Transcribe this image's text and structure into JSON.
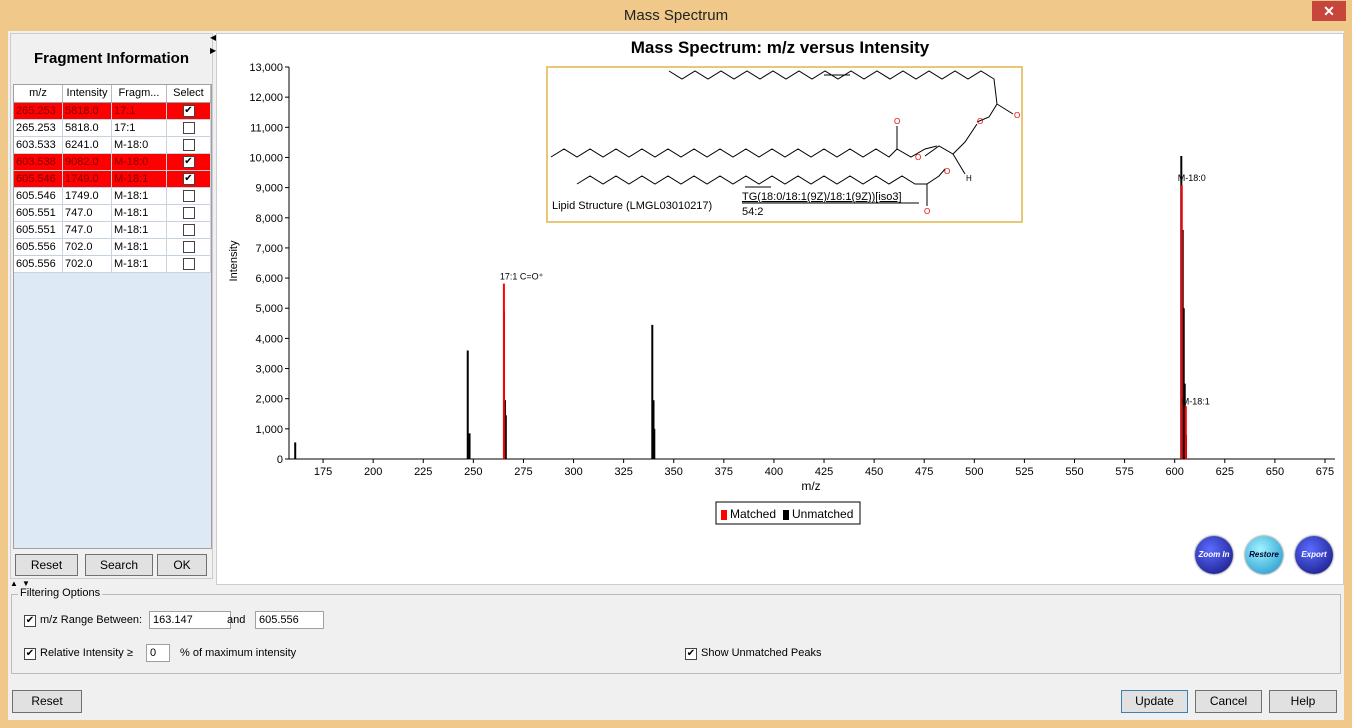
{
  "window": {
    "title": "Mass Spectrum",
    "close_glyph": "✕"
  },
  "fragment_panel": {
    "title": "Fragment Information",
    "columns": [
      "m/z",
      "Intensity",
      "Fragm...",
      "Select"
    ],
    "rows": [
      {
        "mz": "265.253",
        "intensity": "5818.0",
        "fragment": "17:1",
        "selected": true,
        "highlight": true
      },
      {
        "mz": "265.253",
        "intensity": "5818.0",
        "fragment": "17:1",
        "selected": false,
        "highlight": false
      },
      {
        "mz": "603.533",
        "intensity": "6241.0",
        "fragment": "M-18:0",
        "selected": false,
        "highlight": false
      },
      {
        "mz": "603.538",
        "intensity": "9082.0",
        "fragment": "M-18:0",
        "selected": true,
        "highlight": true
      },
      {
        "mz": "605.546",
        "intensity": "1749.0",
        "fragment": "M-18:1",
        "selected": true,
        "highlight": true
      },
      {
        "mz": "605.546",
        "intensity": "1749.0",
        "fragment": "M-18:1",
        "selected": false,
        "highlight": false
      },
      {
        "mz": "605.551",
        "intensity": "747.0",
        "fragment": "M-18:1",
        "selected": false,
        "highlight": false
      },
      {
        "mz": "605.551",
        "intensity": "747.0",
        "fragment": "M-18:1",
        "selected": false,
        "highlight": false
      },
      {
        "mz": "605.556",
        "intensity": "702.0",
        "fragment": "M-18:1",
        "selected": false,
        "highlight": false
      },
      {
        "mz": "605.556",
        "intensity": "702.0",
        "fragment": "M-18:1",
        "selected": false,
        "highlight": false
      }
    ],
    "buttons": {
      "reset": "Reset",
      "search": "Search",
      "ok": "OK"
    }
  },
  "structure": {
    "caption": "Lipid Structure (LMGL03010217)",
    "name": "TG(18:0/18:1(9Z)/18:1(9Z))[iso3]",
    "sum": "54:2",
    "atom_o": "O",
    "atom_h": "H"
  },
  "chart_buttons": {
    "zoom_in": "Zoom In",
    "restore": "Restore",
    "export": "Export"
  },
  "chart_data": {
    "type": "bar",
    "title": "Mass Spectrum: m/z versus Intensity",
    "xlabel": "m/z",
    "ylabel": "Intensity",
    "xlim": [
      158,
      680
    ],
    "ylim": [
      0,
      13000
    ],
    "xticks": [
      175,
      200,
      225,
      250,
      275,
      300,
      325,
      350,
      375,
      400,
      425,
      450,
      475,
      500,
      525,
      550,
      575,
      600,
      625,
      650,
      675
    ],
    "yticks": [
      0,
      1000,
      2000,
      3000,
      4000,
      5000,
      6000,
      7000,
      8000,
      9000,
      10000,
      11000,
      12000,
      13000
    ],
    "ytick_labels": [
      "0",
      "1,000",
      "2,000",
      "3,000",
      "4,000",
      "5,000",
      "6,000",
      "7,000",
      "8,000",
      "9,000",
      "10,000",
      "11,000",
      "12,000",
      "13,000"
    ],
    "series": [
      {
        "name": "Matched",
        "color": "#ff0000",
        "x": [
          265.253,
          603.538,
          605.546
        ],
        "y": [
          5818,
          9082,
          1749
        ]
      },
      {
        "name": "Unmatched",
        "color": "#000000",
        "x": [
          161.1,
          247.2,
          248.1,
          265.3,
          265.8,
          266.2,
          339.3,
          339.9,
          340.3,
          603.3,
          603.4,
          603.6,
          604.0,
          604.5,
          605.0,
          605.3,
          605.6
        ],
        "y": [
          550,
          3600,
          850,
          4900,
          1950,
          1450,
          4450,
          1950,
          1000,
          10050,
          6200,
          6800,
          7600,
          5000,
          2500,
          1750,
          800
        ]
      }
    ],
    "annotations": [
      {
        "x": 265.253,
        "y": 5818,
        "text": "17:1 C=O⁺"
      },
      {
        "x": 603.538,
        "y": 9082,
        "text": "M-18:0"
      },
      {
        "x": 605.546,
        "y": 1749,
        "text": "M-18:1"
      }
    ],
    "legend": {
      "placement": "bottom-center",
      "entries": [
        "Matched",
        "Unmatched"
      ]
    }
  },
  "filtering": {
    "title": "Filtering Options",
    "mz_range_label": "m/z Range Between:",
    "mz_range_checked": true,
    "mz_min": "163.147",
    "and_label": "and",
    "mz_max": "605.556",
    "rel_intensity_label": "Relative Intensity ≥",
    "rel_intensity_checked": true,
    "rel_intensity_value": "0",
    "rel_intensity_suffix": "% of maximum intensity",
    "show_unmatched_label": "Show Unmatched Peaks",
    "show_unmatched_checked": true
  },
  "footer": {
    "reset": "Reset",
    "update": "Update",
    "cancel": "Cancel",
    "help": "Help"
  }
}
